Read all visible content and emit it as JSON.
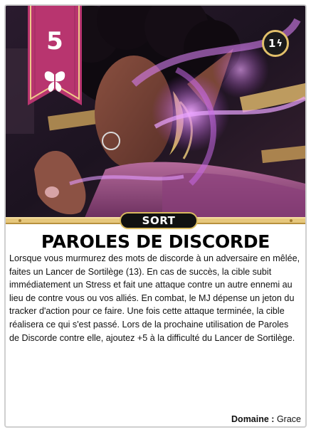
{
  "card": {
    "level": "5",
    "cost": "1",
    "type": "SORT",
    "title": "PAROLES DE DISCORDE",
    "description": "Lorsque vous murmurez des mots de discorde à un adversaire en mêlée, faites un Lancer de Sortilège (13). En cas de succès, la cible subit immédiatement un Stress et fait une attaque contre un autre ennemi au lieu de contre vous ou vos alliés. En combat, le MJ dépense un jeton du tracker d'action pour ce faire. Une fois cette attaque terminée, la cible réalisera ce qui s'est passé. Lors de la prochaine utilisation de Paroles de Discorde contre elle, ajoutez +5 à la difficulté du Lancer de Sortilège.",
    "domain_label": "Domaine :",
    "domain_value": "Grace",
    "domain_icon": "butterfly-icon",
    "cost_icon": "recall-bolt-icon",
    "colors": {
      "banner": "#b8356f",
      "gold": "#d9b95e",
      "magic": "#c26bd6"
    }
  }
}
